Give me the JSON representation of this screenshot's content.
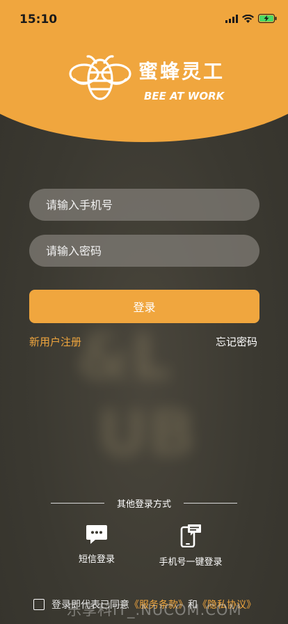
{
  "status_bar": {
    "time": "15:10"
  },
  "brand": {
    "name_cn": "蜜蜂灵工",
    "name_en": "BEE AT WORK"
  },
  "form": {
    "phone_placeholder": "请输入手机号",
    "password_placeholder": "请输入密码",
    "login_label": "登录",
    "register_label": "新用户注册",
    "forgot_label": "忘记密码"
  },
  "other_login": {
    "title": "其他登录方式",
    "methods": [
      {
        "label": "短信登录",
        "icon": "sms-chat-icon"
      },
      {
        "label": "手机号一键登录",
        "icon": "phone-message-icon"
      }
    ]
  },
  "agreement": {
    "text_prefix": "登录即代表已同意",
    "service_terms": "《服务条款》",
    "and_text": "和",
    "privacy_policy": "《隐私协议》"
  },
  "watermark": "乐享科IT_.NUCOM.COM",
  "colors": {
    "accent": "#f0a63e",
    "background": "#3b3931"
  }
}
